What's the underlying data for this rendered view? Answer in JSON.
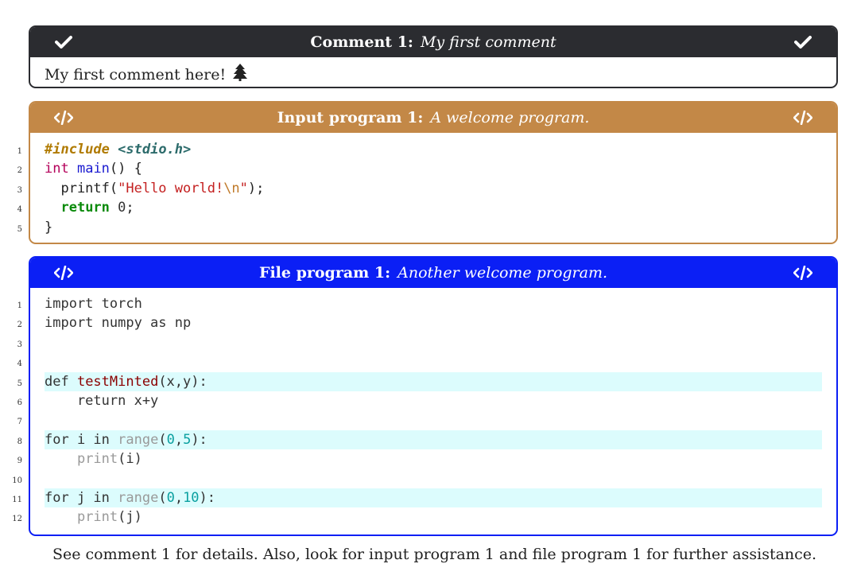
{
  "comment": {
    "title_bold": "Comment 1:",
    "title_italic": "My first comment",
    "body": "My first comment here!",
    "icons": [
      "check-icon",
      "tree-icon"
    ]
  },
  "input_program": {
    "title_bold": "Input program 1:",
    "title_italic": "A welcome program.",
    "line_numbers": [
      "1",
      "2",
      "3",
      "4",
      "5"
    ],
    "lines": [
      "#include <stdio.h>",
      "int main() {",
      "  printf(\"Hello world!\\n\");",
      "  return 0;",
      "}"
    ],
    "icon": "code-icon"
  },
  "file_program": {
    "title_bold": "File program 1:",
    "title_italic": "Another welcome program.",
    "line_numbers": [
      "1",
      "2",
      "3",
      "4",
      "5",
      "6",
      "7",
      "8",
      "9",
      "10",
      "11",
      "12"
    ],
    "lines": [
      "import torch",
      "import numpy as np",
      "",
      "",
      "def testMinted(x,y):",
      "    return x+y",
      "",
      "for i in range(0,5):",
      "    print(i)",
      "",
      "for j in range(0,10):",
      "    print(j)"
    ],
    "highlighted_lines": [
      5,
      8,
      11
    ],
    "icon": "code-icon"
  },
  "footer": "See comment 1 for details. Also, look for input program 1 and file program 1 for further assistance.",
  "colors": {
    "comment": "#2b2c30",
    "input": "#c38847",
    "file": "#0b1ff5",
    "highlight": "#dcfcfd"
  }
}
